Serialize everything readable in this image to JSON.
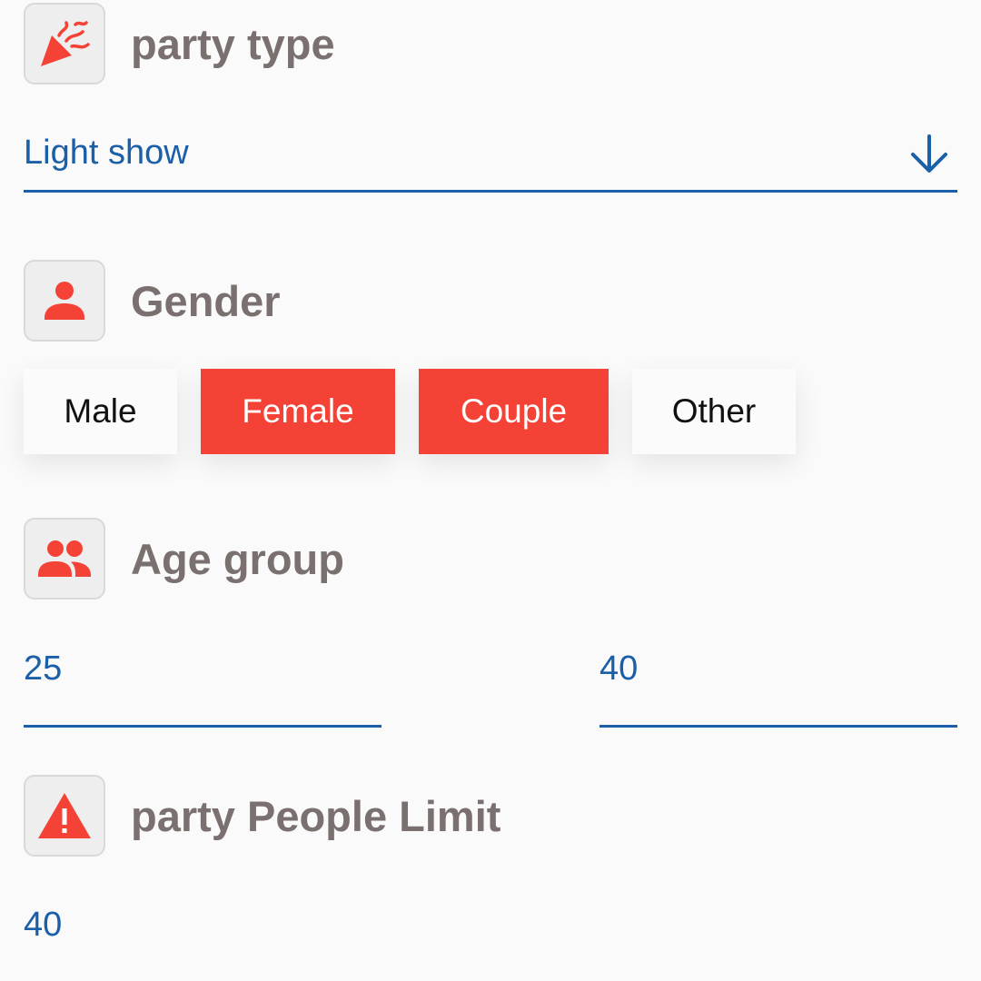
{
  "party_type": {
    "title": "party type",
    "icon": "party-popper-icon",
    "selected_value": "Light show"
  },
  "gender": {
    "title": "Gender",
    "icon": "person-icon",
    "options": [
      {
        "label": "Male",
        "selected": false
      },
      {
        "label": "Female",
        "selected": true
      },
      {
        "label": "Couple",
        "selected": true
      },
      {
        "label": "Other",
        "selected": false
      }
    ]
  },
  "age_group": {
    "title": "Age group",
    "icon": "people-icon",
    "min_value": "25",
    "max_value": "40"
  },
  "people_limit": {
    "title": "party People Limit",
    "icon": "warning-icon",
    "value": "40"
  },
  "colors": {
    "accent": "#f44336",
    "input": "#1a5fa8",
    "title_text": "#7b7070",
    "background": "#fafafa"
  }
}
